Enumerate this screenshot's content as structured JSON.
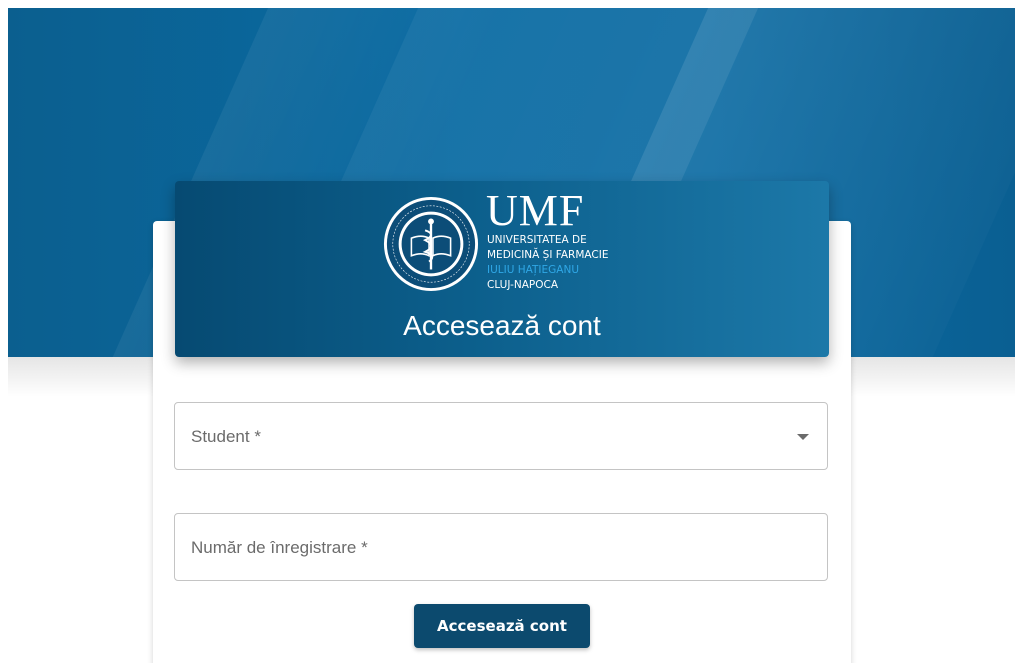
{
  "brand": {
    "logo_title": "UMF",
    "logo_lines": [
      "UNIVERSITATEA DE",
      "MEDICINĂ ȘI FARMACIE",
      "IULIU HAȚIEGANU",
      "CLUJ-NAPOCA"
    ],
    "seal_text": "UNIVERSITAS MEDICINAE ET PHARMACIAE NAPOCENSIS",
    "accent_color": "#2fa7e6"
  },
  "login": {
    "title": "Accesează cont",
    "fields": [
      {
        "label": "Student *",
        "type": "select"
      },
      {
        "label": "Număr de înregistrare *",
        "type": "text"
      }
    ],
    "submit_label": "Accesează cont"
  },
  "colors": {
    "hero": "#0a6aa2",
    "header": "#0c5f8c",
    "button": "#0c4a6e"
  }
}
